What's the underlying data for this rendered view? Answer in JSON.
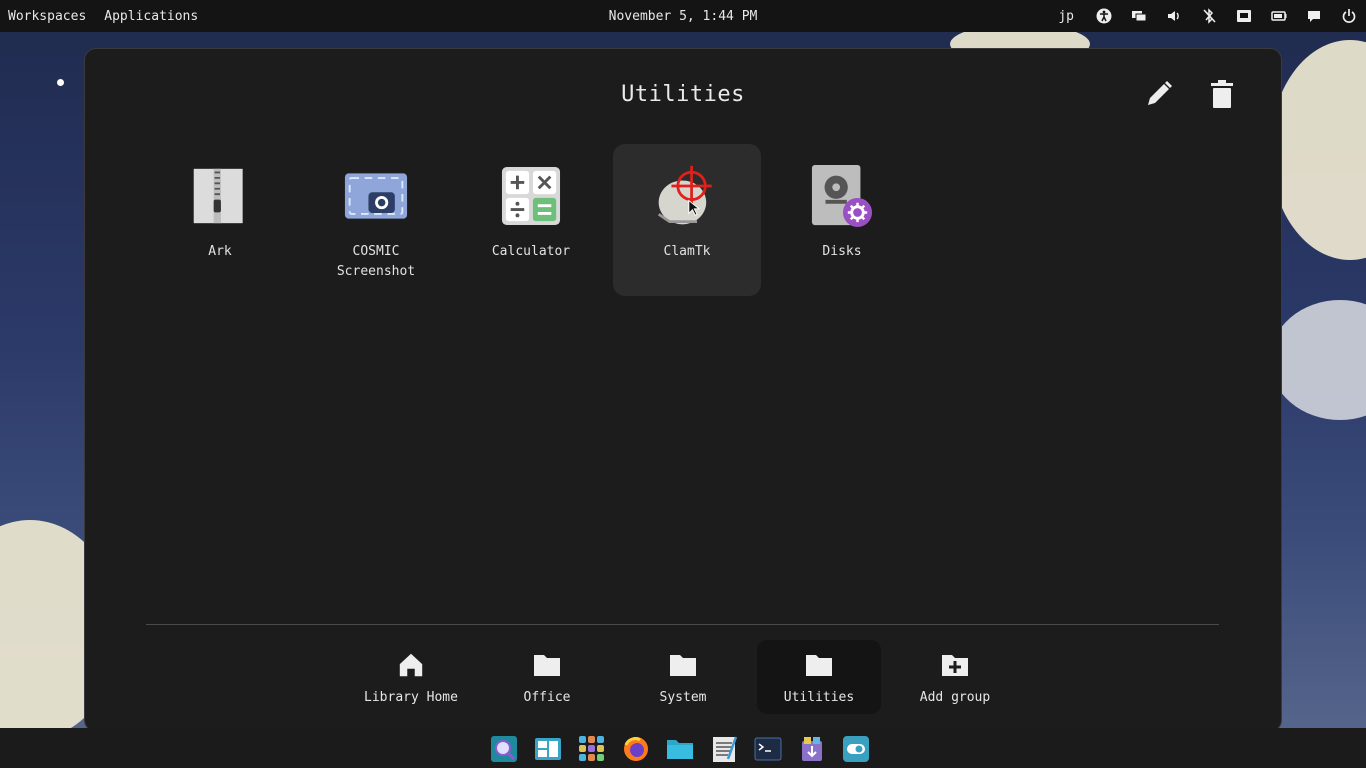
{
  "top_panel": {
    "workspaces": "Workspaces",
    "applications": "Applications",
    "clock": "November 5, 1:44 PM",
    "input_method": "jp",
    "tray_icons": [
      "accessibility-icon",
      "display-icon",
      "volume-icon",
      "bluetooth-off-icon",
      "network-icon",
      "battery-icon",
      "notifications-icon",
      "power-icon"
    ]
  },
  "launcher": {
    "group_title": "Utilities",
    "edit_icon": "pencil-icon",
    "delete_icon": "trash-icon",
    "apps": [
      {
        "name": "Ark",
        "icon": "archive-zip-icon"
      },
      {
        "name": "COSMIC Screenshot",
        "icon": "screenshot-camera-icon"
      },
      {
        "name": "Calculator",
        "icon": "calculator-icon"
      },
      {
        "name": "ClamTk",
        "icon": "clamtk-crosshair-icon",
        "active": true
      },
      {
        "name": "Disks",
        "icon": "disks-icon"
      }
    ],
    "groups": [
      {
        "name": "Library Home",
        "icon": "home-icon"
      },
      {
        "name": "Office",
        "icon": "folder-icon"
      },
      {
        "name": "System",
        "icon": "folder-icon"
      },
      {
        "name": "Utilities",
        "icon": "folder-icon",
        "active": true
      },
      {
        "name": "Add group",
        "icon": "folder-add-icon"
      }
    ]
  },
  "dock": {
    "items": [
      "launcher-search-icon",
      "workspaces-icon",
      "app-library-icon",
      "firefox-icon",
      "files-icon",
      "text-editor-icon",
      "terminal-icon",
      "store-icon",
      "settings-icon"
    ]
  },
  "colors": {
    "panel_bg": "#141414",
    "window_bg": "#1c1c1c",
    "active_tile": "#2c2c2c",
    "clamtk_red": "#e0201a",
    "disks_badge": "#9b4fc4"
  }
}
